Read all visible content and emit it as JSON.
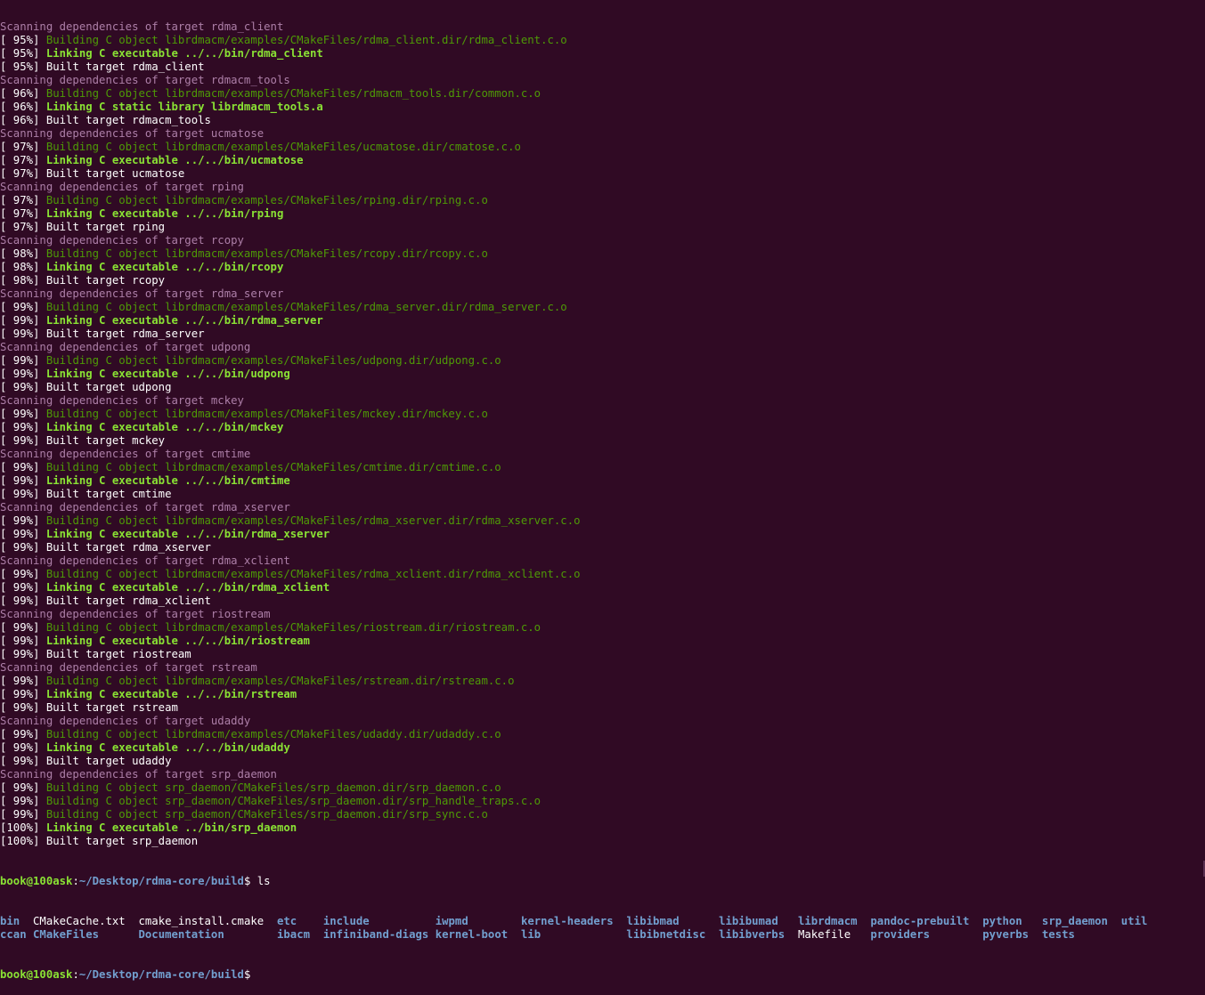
{
  "terminal": {
    "log": [
      {
        "pct": "",
        "kind": "scan",
        "text": "Scanning dependencies of target rdma_client"
      },
      {
        "pct": "[ 95%] ",
        "kind": "build",
        "text": "Building C object librdmacm/examples/CMakeFiles/rdma_client.dir/rdma_client.c.o"
      },
      {
        "pct": "[ 95%] ",
        "kind": "link",
        "text": "Linking C executable ../../bin/rdma_client"
      },
      {
        "pct": "[ 95%] ",
        "kind": "plain",
        "text": "Built target rdma_client"
      },
      {
        "pct": "",
        "kind": "scan",
        "text": "Scanning dependencies of target rdmacm_tools"
      },
      {
        "pct": "[ 96%] ",
        "kind": "build",
        "text": "Building C object librdmacm/examples/CMakeFiles/rdmacm_tools.dir/common.c.o"
      },
      {
        "pct": "[ 96%] ",
        "kind": "link",
        "text": "Linking C static library librdmacm_tools.a"
      },
      {
        "pct": "[ 96%] ",
        "kind": "plain",
        "text": "Built target rdmacm_tools"
      },
      {
        "pct": "",
        "kind": "scan",
        "text": "Scanning dependencies of target ucmatose"
      },
      {
        "pct": "[ 97%] ",
        "kind": "build",
        "text": "Building C object librdmacm/examples/CMakeFiles/ucmatose.dir/cmatose.c.o"
      },
      {
        "pct": "[ 97%] ",
        "kind": "link",
        "text": "Linking C executable ../../bin/ucmatose"
      },
      {
        "pct": "[ 97%] ",
        "kind": "plain",
        "text": "Built target ucmatose"
      },
      {
        "pct": "",
        "kind": "scan",
        "text": "Scanning dependencies of target rping"
      },
      {
        "pct": "[ 97%] ",
        "kind": "build",
        "text": "Building C object librdmacm/examples/CMakeFiles/rping.dir/rping.c.o"
      },
      {
        "pct": "[ 97%] ",
        "kind": "link",
        "text": "Linking C executable ../../bin/rping"
      },
      {
        "pct": "[ 97%] ",
        "kind": "plain",
        "text": "Built target rping"
      },
      {
        "pct": "",
        "kind": "scan",
        "text": "Scanning dependencies of target rcopy"
      },
      {
        "pct": "[ 98%] ",
        "kind": "build",
        "text": "Building C object librdmacm/examples/CMakeFiles/rcopy.dir/rcopy.c.o"
      },
      {
        "pct": "[ 98%] ",
        "kind": "link",
        "text": "Linking C executable ../../bin/rcopy"
      },
      {
        "pct": "[ 98%] ",
        "kind": "plain",
        "text": "Built target rcopy"
      },
      {
        "pct": "",
        "kind": "scan",
        "text": "Scanning dependencies of target rdma_server"
      },
      {
        "pct": "[ 99%] ",
        "kind": "build",
        "text": "Building C object librdmacm/examples/CMakeFiles/rdma_server.dir/rdma_server.c.o"
      },
      {
        "pct": "[ 99%] ",
        "kind": "link",
        "text": "Linking C executable ../../bin/rdma_server"
      },
      {
        "pct": "[ 99%] ",
        "kind": "plain",
        "text": "Built target rdma_server"
      },
      {
        "pct": "",
        "kind": "scan",
        "text": "Scanning dependencies of target udpong"
      },
      {
        "pct": "[ 99%] ",
        "kind": "build",
        "text": "Building C object librdmacm/examples/CMakeFiles/udpong.dir/udpong.c.o"
      },
      {
        "pct": "[ 99%] ",
        "kind": "link",
        "text": "Linking C executable ../../bin/udpong"
      },
      {
        "pct": "[ 99%] ",
        "kind": "plain",
        "text": "Built target udpong"
      },
      {
        "pct": "",
        "kind": "scan",
        "text": "Scanning dependencies of target mckey"
      },
      {
        "pct": "[ 99%] ",
        "kind": "build",
        "text": "Building C object librdmacm/examples/CMakeFiles/mckey.dir/mckey.c.o"
      },
      {
        "pct": "[ 99%] ",
        "kind": "link",
        "text": "Linking C executable ../../bin/mckey"
      },
      {
        "pct": "[ 99%] ",
        "kind": "plain",
        "text": "Built target mckey"
      },
      {
        "pct": "",
        "kind": "scan",
        "text": "Scanning dependencies of target cmtime"
      },
      {
        "pct": "[ 99%] ",
        "kind": "build",
        "text": "Building C object librdmacm/examples/CMakeFiles/cmtime.dir/cmtime.c.o"
      },
      {
        "pct": "[ 99%] ",
        "kind": "link",
        "text": "Linking C executable ../../bin/cmtime"
      },
      {
        "pct": "[ 99%] ",
        "kind": "plain",
        "text": "Built target cmtime"
      },
      {
        "pct": "",
        "kind": "scan",
        "text": "Scanning dependencies of target rdma_xserver"
      },
      {
        "pct": "[ 99%] ",
        "kind": "build",
        "text": "Building C object librdmacm/examples/CMakeFiles/rdma_xserver.dir/rdma_xserver.c.o"
      },
      {
        "pct": "[ 99%] ",
        "kind": "link",
        "text": "Linking C executable ../../bin/rdma_xserver"
      },
      {
        "pct": "[ 99%] ",
        "kind": "plain",
        "text": "Built target rdma_xserver"
      },
      {
        "pct": "",
        "kind": "scan",
        "text": "Scanning dependencies of target rdma_xclient"
      },
      {
        "pct": "[ 99%] ",
        "kind": "build",
        "text": "Building C object librdmacm/examples/CMakeFiles/rdma_xclient.dir/rdma_xclient.c.o"
      },
      {
        "pct": "[ 99%] ",
        "kind": "link",
        "text": "Linking C executable ../../bin/rdma_xclient"
      },
      {
        "pct": "[ 99%] ",
        "kind": "plain",
        "text": "Built target rdma_xclient"
      },
      {
        "pct": "",
        "kind": "scan",
        "text": "Scanning dependencies of target riostream"
      },
      {
        "pct": "[ 99%] ",
        "kind": "build",
        "text": "Building C object librdmacm/examples/CMakeFiles/riostream.dir/riostream.c.o"
      },
      {
        "pct": "[ 99%] ",
        "kind": "link",
        "text": "Linking C executable ../../bin/riostream"
      },
      {
        "pct": "[ 99%] ",
        "kind": "plain",
        "text": "Built target riostream"
      },
      {
        "pct": "",
        "kind": "scan",
        "text": "Scanning dependencies of target rstream"
      },
      {
        "pct": "[ 99%] ",
        "kind": "build",
        "text": "Building C object librdmacm/examples/CMakeFiles/rstream.dir/rstream.c.o"
      },
      {
        "pct": "[ 99%] ",
        "kind": "link",
        "text": "Linking C executable ../../bin/rstream"
      },
      {
        "pct": "[ 99%] ",
        "kind": "plain",
        "text": "Built target rstream"
      },
      {
        "pct": "",
        "kind": "scan",
        "text": "Scanning dependencies of target udaddy"
      },
      {
        "pct": "[ 99%] ",
        "kind": "build",
        "text": "Building C object librdmacm/examples/CMakeFiles/udaddy.dir/udaddy.c.o"
      },
      {
        "pct": "[ 99%] ",
        "kind": "link",
        "text": "Linking C executable ../../bin/udaddy"
      },
      {
        "pct": "[ 99%] ",
        "kind": "plain",
        "text": "Built target udaddy"
      },
      {
        "pct": "",
        "kind": "scan",
        "text": "Scanning dependencies of target srp_daemon"
      },
      {
        "pct": "[ 99%] ",
        "kind": "build",
        "text": "Building C object srp_daemon/CMakeFiles/srp_daemon.dir/srp_daemon.c.o"
      },
      {
        "pct": "[ 99%] ",
        "kind": "build",
        "text": "Building C object srp_daemon/CMakeFiles/srp_daemon.dir/srp_handle_traps.c.o"
      },
      {
        "pct": "[ 99%] ",
        "kind": "build",
        "text": "Building C object srp_daemon/CMakeFiles/srp_daemon.dir/srp_sync.c.o"
      },
      {
        "pct": "[100%] ",
        "kind": "link",
        "text": "Linking C executable ../bin/srp_daemon"
      },
      {
        "pct": "[100%] ",
        "kind": "plain",
        "text": "Built target srp_daemon"
      }
    ],
    "prompt": {
      "user_host": "book@100ask",
      "colon": ":",
      "path": "~/Desktop/rdma-core/build",
      "dollar": "$ ",
      "command": "ls"
    },
    "ls_rows": [
      [
        {
          "name": "bin",
          "type": "dir",
          "pad": "  "
        },
        {
          "name": "CMakeCache.txt",
          "type": "file",
          "pad": "  "
        },
        {
          "name": "cmake_install.cmake",
          "type": "file",
          "pad": "  "
        },
        {
          "name": "etc",
          "type": "dir",
          "pad": "    "
        },
        {
          "name": "include",
          "type": "dir",
          "pad": "          "
        },
        {
          "name": "iwpmd",
          "type": "dir",
          "pad": "        "
        },
        {
          "name": "kernel-headers",
          "type": "dir",
          "pad": "  "
        },
        {
          "name": "libibmad",
          "type": "dir",
          "pad": "      "
        },
        {
          "name": "libibumad",
          "type": "dir",
          "pad": "   "
        },
        {
          "name": "librdmacm",
          "type": "dir",
          "pad": "  "
        },
        {
          "name": "pandoc-prebuilt",
          "type": "dir",
          "pad": "  "
        },
        {
          "name": "python",
          "type": "dir",
          "pad": "   "
        },
        {
          "name": "srp_daemon",
          "type": "dir",
          "pad": "  "
        },
        {
          "name": "util",
          "type": "dir",
          "pad": ""
        }
      ],
      [
        {
          "name": "ccan",
          "type": "dir",
          "pad": " "
        },
        {
          "name": "CMakeFiles",
          "type": "dir",
          "pad": "      "
        },
        {
          "name": "Documentation",
          "type": "dir",
          "pad": "        "
        },
        {
          "name": "ibacm",
          "type": "dir",
          "pad": "  "
        },
        {
          "name": "infiniband-diags",
          "type": "dir",
          "pad": " "
        },
        {
          "name": "kernel-boot",
          "type": "dir",
          "pad": "  "
        },
        {
          "name": "lib",
          "type": "dir",
          "pad": "             "
        },
        {
          "name": "libibnetdisc",
          "type": "dir",
          "pad": "  "
        },
        {
          "name": "libibverbs",
          "type": "dir",
          "pad": "  "
        },
        {
          "name": "Makefile",
          "type": "file",
          "pad": "   "
        },
        {
          "name": "providers",
          "type": "dir",
          "pad": "        "
        },
        {
          "name": "pyverbs",
          "type": "dir",
          "pad": "  "
        },
        {
          "name": "tests",
          "type": "dir",
          "pad": ""
        }
      ]
    ],
    "final_prompt": {
      "user_host": "book@100ask",
      "colon": ":",
      "path": "~/Desktop/rdma-core/build",
      "dollar": "$"
    }
  }
}
